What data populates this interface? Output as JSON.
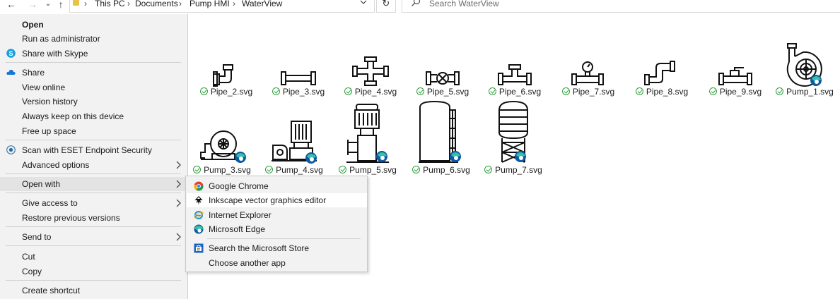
{
  "address_bar": {
    "crumbs": [
      "This PC",
      "Documents",
      "Pump HMI",
      "WaterView"
    ],
    "search_placeholder": "Search WaterView"
  },
  "context_menu": {
    "items": [
      {
        "label": "Open",
        "bold": true
      },
      {
        "label": "Run as administrator"
      },
      {
        "label": "Share with Skype",
        "icon": "skype-icon"
      },
      {
        "label": "Share",
        "icon": "onedrive-cloud-icon"
      },
      {
        "label": "View online"
      },
      {
        "label": "Version history"
      },
      {
        "label": "Always keep on this device"
      },
      {
        "label": "Free up space"
      },
      {
        "label": "Scan with ESET Endpoint Security",
        "icon": "eset-icon"
      },
      {
        "label": "Advanced options",
        "submenu": true
      },
      {
        "label": "Open with",
        "submenu": true,
        "highlighted": true
      },
      {
        "label": "Give access to",
        "submenu": true
      },
      {
        "label": "Restore previous versions"
      },
      {
        "label": "Send to",
        "submenu": true
      },
      {
        "label": "Cut"
      },
      {
        "label": "Copy"
      },
      {
        "label": "Create shortcut"
      }
    ]
  },
  "open_with_submenu": {
    "items": [
      {
        "label": "Google Chrome",
        "icon": "chrome-icon"
      },
      {
        "label": "Inkscape vector graphics editor",
        "icon": "inkscape-icon",
        "highlighted": true
      },
      {
        "label": "Internet Explorer",
        "icon": "internet-explorer-icon"
      },
      {
        "label": "Microsoft Edge",
        "icon": "edge-icon"
      },
      {
        "label": "Search the Microsoft Store",
        "icon": "store-icon"
      },
      {
        "label": "Choose another app"
      }
    ]
  },
  "files": [
    {
      "name": "Pipe_2.svg",
      "icon": "pipe-elbow-icon",
      "sync": "synced"
    },
    {
      "name": "Pipe_3.svg",
      "icon": "pipe-straight-icon",
      "sync": "synced"
    },
    {
      "name": "Pipe_4.svg",
      "icon": "pipe-cross-icon",
      "sync": "synced"
    },
    {
      "name": "Pipe_5.svg",
      "icon": "pipe-valve-icon",
      "sync": "synced"
    },
    {
      "name": "Pipe_6.svg",
      "icon": "pipe-tee-icon",
      "sync": "synced"
    },
    {
      "name": "Pipe_7.svg",
      "icon": "pipe-gauge-icon",
      "sync": "synced"
    },
    {
      "name": "Pipe_8.svg",
      "icon": "pipe-offset-icon",
      "sync": "synced"
    },
    {
      "name": "Pipe_9.svg",
      "icon": "pipe-ball-valve-icon",
      "sync": "synced"
    },
    {
      "name": "Pump_1.svg",
      "icon": "centrifugal-pump-icon",
      "sync": "synced"
    },
    {
      "name": "Pump_3.svg",
      "icon": "pump-horizontal-icon",
      "sync": "synced"
    },
    {
      "name": "Pump_4.svg",
      "icon": "pump-motor-icon",
      "sync": "synced"
    },
    {
      "name": "Pump_5.svg",
      "icon": "pump-vertical-icon",
      "sync": "synced"
    },
    {
      "name": "Pump_6.svg",
      "icon": "tank-icon",
      "sync": "synced"
    },
    {
      "name": "Pump_7.svg",
      "icon": "tower-tank-icon",
      "sync": "synced"
    }
  ],
  "colors": {
    "menu_bg": "#f2f2f2",
    "menu_highlight": "#e3e3e3",
    "sync_green": "#2f9d3b",
    "edge_blue": "#0c59a4",
    "edge_green": "#35c1a5"
  }
}
